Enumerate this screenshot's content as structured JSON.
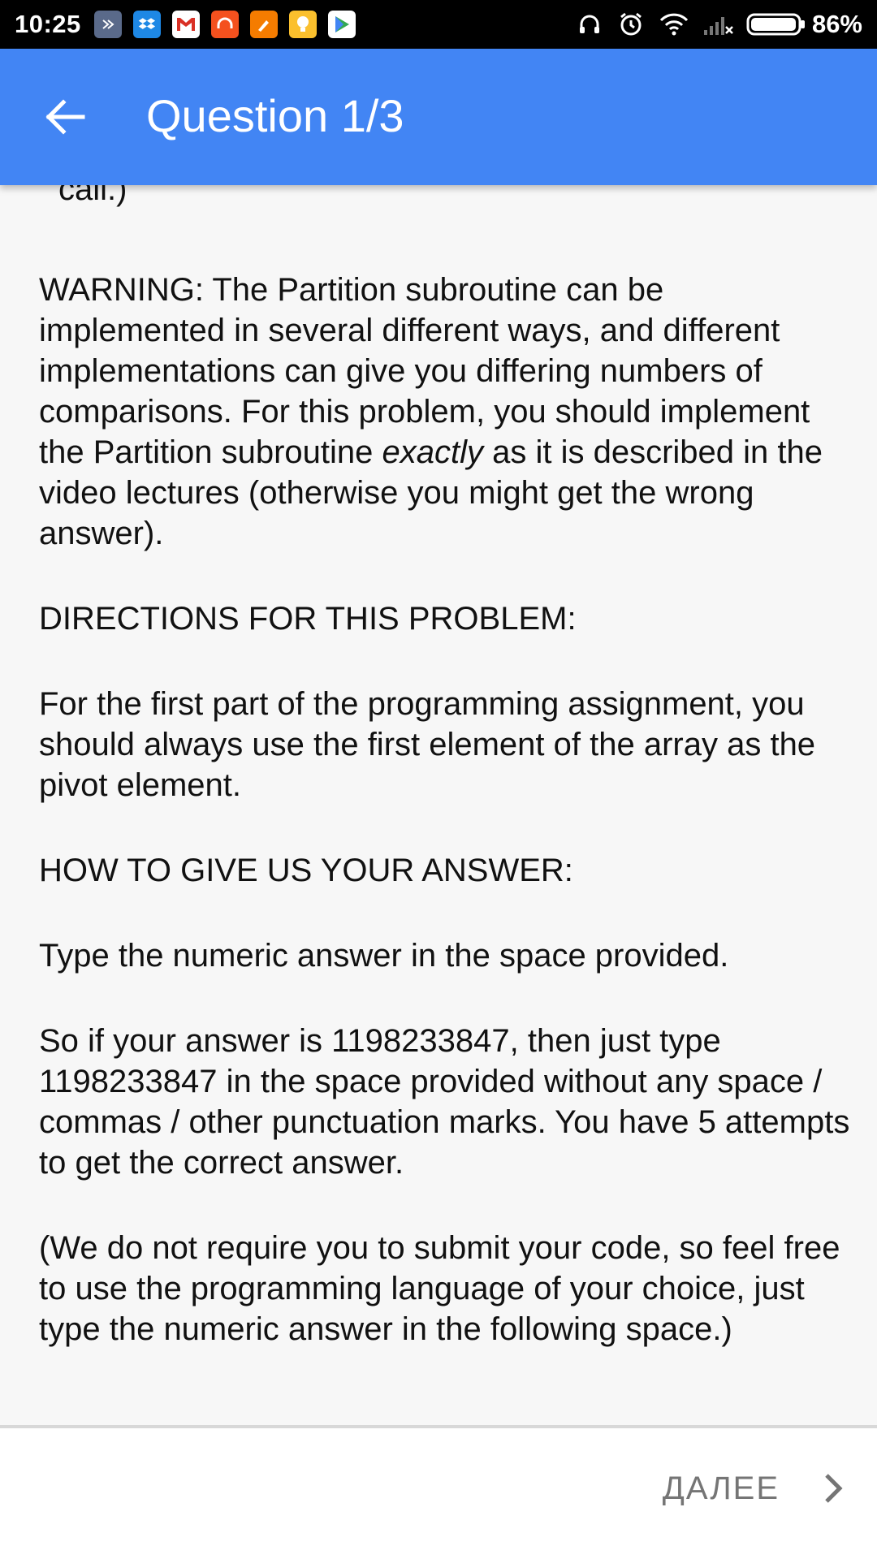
{
  "status_bar": {
    "time": "10:25",
    "battery": "86%",
    "notification_icons": [
      "app-icon",
      "dropbox-icon",
      "gmail-icon",
      "headphones-app-icon",
      "brush-app-icon",
      "bulb-app-icon",
      "play-store-icon"
    ],
    "system_icons": [
      "headphones-icon",
      "alarm-icon",
      "wifi-icon",
      "no-signal-icon",
      "battery-icon"
    ]
  },
  "app_bar": {
    "title": "Question 1/3",
    "color": "#4285f4"
  },
  "content": {
    "partial_top_line": "call.)",
    "warning": {
      "before_emphasis": "WARNING: The Partition subroutine can be implemented in several different ways, and different implementations can give you differing numbers of comparisons. For this problem, you should implement the Partition subroutine ",
      "emphasis": "exactly",
      "after_emphasis": " as it is described in the video lectures (otherwise you might get the wrong answer)."
    },
    "directions_heading": "DIRECTIONS FOR THIS PROBLEM:",
    "directions_text": "For the first part of the programming assignment, you should always use the first element of the array as the pivot element.",
    "answer_heading": "HOW TO GIVE US YOUR ANSWER:",
    "answer_instruction": "Type the numeric answer in the space provided.",
    "answer_example": "So if your answer is 1198233847, then just type 1198233847 in the space provided without any space / commas / other punctuation marks. You have 5 attempts to get the correct answer.",
    "code_note": "(We do not require you to submit your code, so feel free to use the programming language of your choice, just type the numeric answer in the following space.)"
  },
  "bottom_bar": {
    "next_label": "ДАЛЕЕ"
  }
}
